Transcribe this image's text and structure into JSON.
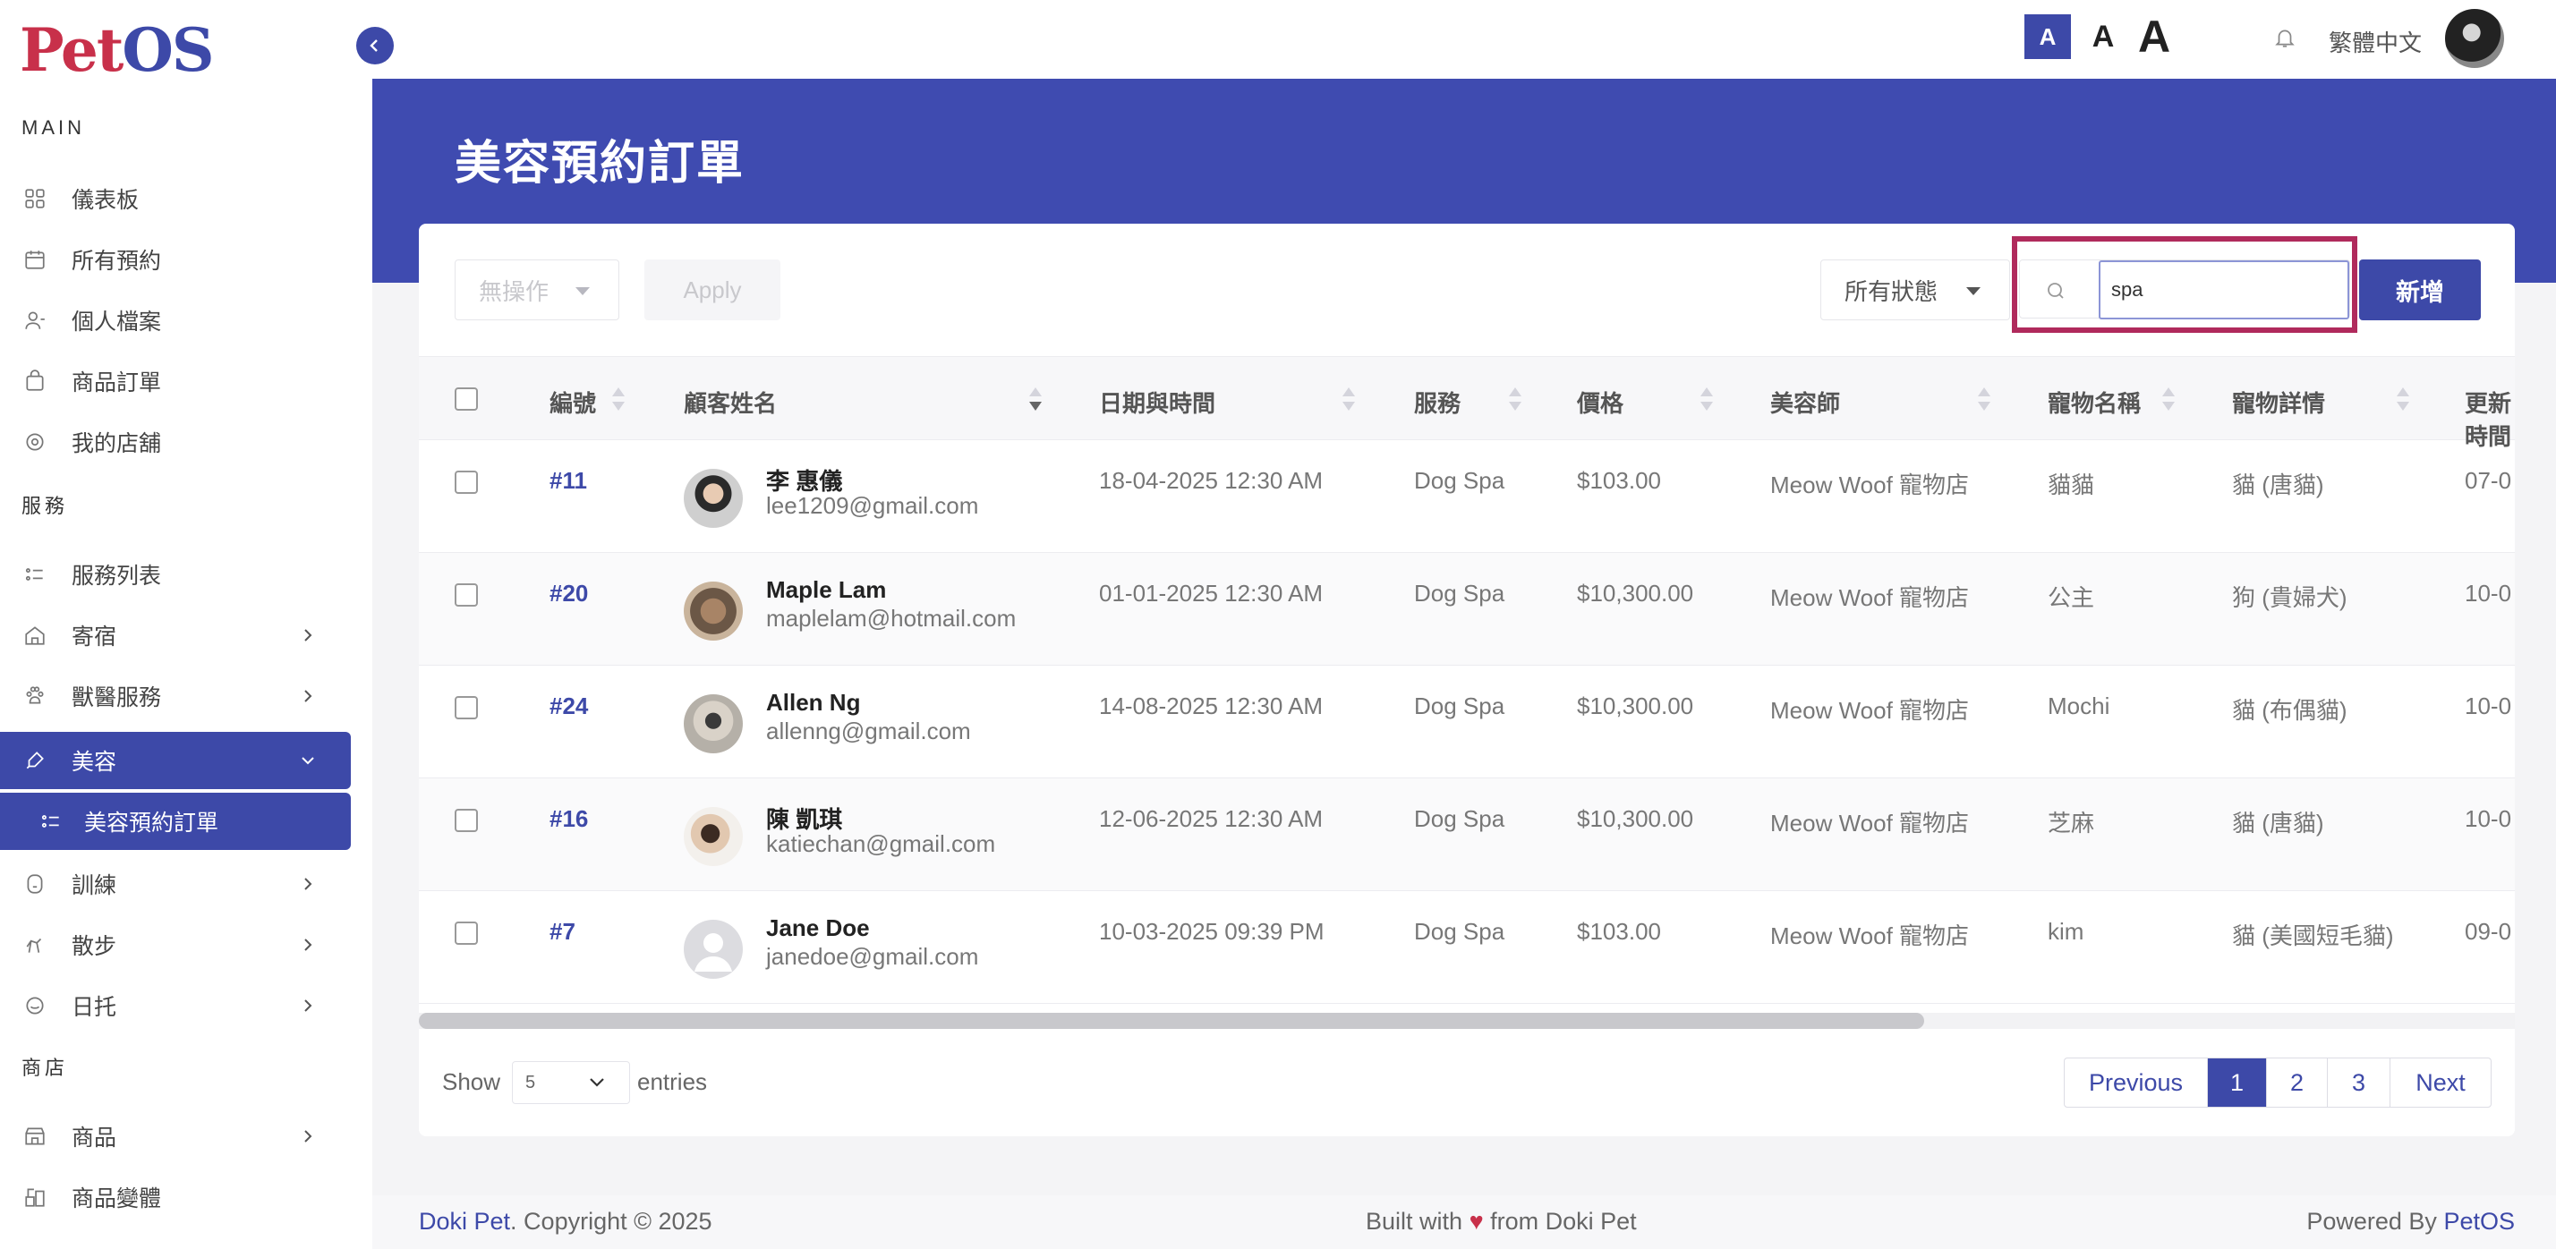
{
  "brand": {
    "logo_part1": "Pet",
    "logo_part2": "OS"
  },
  "sidebar": {
    "sections": {
      "main": "MAIN",
      "service": "服務",
      "shop": "商店"
    },
    "main_items": [
      {
        "label": "儀表板",
        "icon": "grid-icon"
      },
      {
        "label": "所有預約",
        "icon": "calendar-icon"
      },
      {
        "label": "個人檔案",
        "icon": "user-icon"
      },
      {
        "label": "商品訂單",
        "icon": "bag-icon"
      },
      {
        "label": "我的店舖",
        "icon": "store-icon"
      }
    ],
    "service_items": [
      {
        "label": "服務列表",
        "icon": "list-icon"
      },
      {
        "label": "寄宿",
        "icon": "home-icon"
      },
      {
        "label": "獸醫服務",
        "icon": "paw-icon"
      },
      {
        "label": "美容",
        "icon": "brush-icon"
      },
      {
        "label": "美容預約訂單",
        "icon": "list-icon"
      },
      {
        "label": "訓練",
        "icon": "dog-icon"
      },
      {
        "label": "散步",
        "icon": "walk-icon"
      },
      {
        "label": "日托",
        "icon": "daycare-icon"
      }
    ],
    "shop_items": [
      {
        "label": "商品",
        "icon": "shop-icon"
      },
      {
        "label": "商品變體",
        "icon": "variant-icon"
      }
    ]
  },
  "topbar": {
    "font_small": "A",
    "font_medium": "A",
    "font_large": "A",
    "language": "繁體中文"
  },
  "page": {
    "title": "美容預約訂單"
  },
  "toolbar": {
    "bulk_action": "無操作",
    "apply_label": "Apply",
    "status_filter": "所有狀態",
    "search_value": "spa",
    "add_label": "新增"
  },
  "table": {
    "headers": [
      "編號",
      "顧客姓名",
      "日期與時間",
      "服務",
      "價格",
      "美容師",
      "寵物名稱",
      "寵物詳情",
      "更新時間"
    ],
    "rows": [
      {
        "id": "#11",
        "name": "李 惠儀",
        "email": "lee1209@gmail.com",
        "datetime": "18-04-2025 12:30 AM",
        "service": "Dog Spa",
        "price": "$103.00",
        "groomer": "Meow Woof 寵物店",
        "pet": "貓貓",
        "pet_detail": "貓 (唐貓)",
        "updated": "07-0"
      },
      {
        "id": "#20",
        "name": "Maple Lam",
        "email": "maplelam@hotmail.com",
        "datetime": "01-01-2025 12:30 AM",
        "service": "Dog Spa",
        "price": "$10,300.00",
        "groomer": "Meow Woof 寵物店",
        "pet": "公主",
        "pet_detail": "狗 (貴婦犬)",
        "updated": "10-0"
      },
      {
        "id": "#24",
        "name": "Allen Ng",
        "email": "allenng@gmail.com",
        "datetime": "14-08-2025 12:30 AM",
        "service": "Dog Spa",
        "price": "$10,300.00",
        "groomer": "Meow Woof 寵物店",
        "pet": "Mochi",
        "pet_detail": "貓 (布偶貓)",
        "updated": "10-0"
      },
      {
        "id": "#16",
        "name": "陳 凱琪",
        "email": "katiechan@gmail.com",
        "datetime": "12-06-2025 12:30 AM",
        "service": "Dog Spa",
        "price": "$10,300.00",
        "groomer": "Meow Woof 寵物店",
        "pet": "芝麻",
        "pet_detail": "貓 (唐貓)",
        "updated": "10-0"
      },
      {
        "id": "#7",
        "name": "Jane Doe",
        "email": "janedoe@gmail.com",
        "datetime": "10-03-2025 09:39 PM",
        "service": "Dog Spa",
        "price": "$103.00",
        "groomer": "Meow Woof 寵物店",
        "pet": "kim",
        "pet_detail": "貓 (美國短毛貓)",
        "updated": "09-0"
      }
    ]
  },
  "pagination": {
    "show_label": "Show",
    "entries_value": "5",
    "entries_label": "entries",
    "prev": "Previous",
    "pages": [
      "1",
      "2",
      "3"
    ],
    "next": "Next",
    "current": "1"
  },
  "footer": {
    "brand": "Doki Pet",
    "copyright": ". Copyright © 2025",
    "built_prefix": "Built with",
    "heart": "♥",
    "built_suffix": "from Doki Pet",
    "powered_prefix": "Powered By",
    "powered_brand": "PetOS"
  },
  "colors": {
    "primary": "#3d49a8",
    "logo_red": "#c8304a",
    "highlight": "#b02a5c"
  }
}
